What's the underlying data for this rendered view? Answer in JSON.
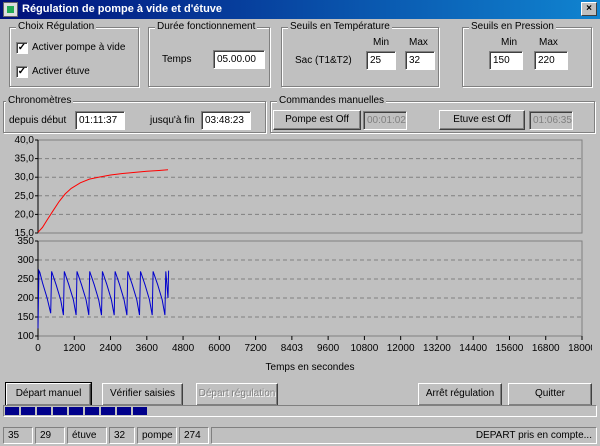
{
  "window": {
    "title": "Régulation de pompe à vide et d'étuve",
    "close_label": "×"
  },
  "choix": {
    "title": "Choix Régulation",
    "pompe_label": "Activer pompe à vide",
    "pompe_checked": true,
    "etuve_label": "Activer étuve",
    "etuve_checked": true,
    "check_mark": "✓"
  },
  "duree": {
    "title": "Durée fonctionnement",
    "temps_label": "Temps",
    "temps_value": "05.00.00"
  },
  "seuils_temp": {
    "title": "Seuils en Température",
    "min_label": "Min",
    "max_label": "Max",
    "sac_label": "Sac (T1&T2)",
    "min_value": "25",
    "max_value": "32"
  },
  "seuils_press": {
    "title": "Seuils en Pression",
    "min_label": "Min",
    "max_label": "Max",
    "min_value": "150",
    "max_value": "220"
  },
  "chrono": {
    "title": "Chronomètres",
    "debut_label": "depuis début",
    "debut_value": "01:11:37",
    "fin_label": "jusqu'à fin",
    "fin_value": "03:48:23"
  },
  "commandes": {
    "title": "Commandes manuelles",
    "pompe_button": "Pompe est Off",
    "pompe_time": "00:01:02",
    "etuve_button": "Etuve est Off",
    "etuve_time": "01:06:35"
  },
  "chart_data": [
    {
      "type": "line",
      "title": "",
      "xlabel": "Temps en secondes",
      "ylabel": "",
      "xlim": [
        0,
        18000
      ],
      "ylim": [
        15,
        40
      ],
      "y_ticks": [
        "15,0",
        "20,0",
        "25,0",
        "30,0",
        "35,0",
        "40,0"
      ],
      "grid": true,
      "series": [
        {
          "color": "#ff0000",
          "x": [
            0,
            150,
            300,
            500,
            700,
            900,
            1100,
            1400,
            1700,
            2000,
            2400,
            2800,
            3200,
            3600,
            4000,
            4300
          ],
          "y": [
            15.2,
            16.5,
            18.5,
            21,
            23.5,
            25.5,
            27,
            28.5,
            29.5,
            30,
            30.6,
            31,
            31.3,
            31.6,
            31.8,
            32
          ]
        }
      ]
    },
    {
      "type": "line",
      "title": "",
      "xlabel": "Temps en secondes",
      "ylabel": "",
      "xlim": [
        0,
        18000
      ],
      "ylim": [
        100,
        350
      ],
      "y_ticks": [
        "100",
        "150",
        "200",
        "250",
        "300",
        "350"
      ],
      "x_ticks": [
        "0",
        "1200",
        "2400",
        "3600",
        "4800",
        "6000",
        "7200",
        "8403",
        "9600",
        "10800",
        "12000",
        "13200",
        "14400",
        "15600",
        "16800",
        "18000"
      ],
      "grid": true,
      "series": [
        {
          "color": "#0000cc",
          "x": [
            0,
            30,
            60,
            150,
            300,
            420,
            450,
            600,
            750,
            840,
            870,
            1020,
            1170,
            1260,
            1290,
            1440,
            1590,
            1680,
            1710,
            1860,
            2010,
            2100,
            2130,
            2280,
            2430,
            2520,
            2550,
            2700,
            2850,
            2940,
            2970,
            3120,
            3270,
            3360,
            3390,
            3540,
            3690,
            3780,
            3810,
            3960,
            4110,
            4200,
            4230,
            4300,
            4320
          ],
          "y": [
            120,
            272,
            268,
            240,
            200,
            160,
            270,
            235,
            195,
            155,
            270,
            235,
            195,
            155,
            270,
            235,
            195,
            155,
            270,
            235,
            195,
            155,
            270,
            235,
            195,
            155,
            270,
            235,
            195,
            155,
            270,
            235,
            195,
            155,
            270,
            235,
            195,
            155,
            270,
            235,
            195,
            155,
            270,
            200,
            272
          ]
        }
      ]
    }
  ],
  "buttons": {
    "depart_manuel": "Départ manuel",
    "verifier": "Vérifier saisies",
    "depart_regulation": "Départ régulation",
    "arret": "Arrêt régulation",
    "quitter": "Quitter"
  },
  "progress": {
    "value_fraction": 0.24
  },
  "status": {
    "c1": "35",
    "c2": "29",
    "c3": "étuve",
    "c4": "32",
    "c5": "pompe",
    "c6": "274",
    "message": "DEPART pris en compte..."
  }
}
